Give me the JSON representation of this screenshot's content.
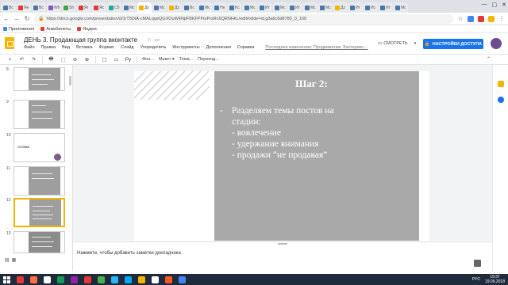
{
  "browser": {
    "tabs": [
      {
        "label": "Bc",
        "color": "#4a76a8"
      },
      {
        "label": "Ян",
        "color": "#e53935"
      },
      {
        "label": "Bc",
        "color": "#4a76a8"
      },
      {
        "label": "Wh",
        "color": "#7e57c2"
      },
      {
        "label": "Sh",
        "color": "#43a047"
      },
      {
        "label": "Яr",
        "color": "#e53935"
      },
      {
        "label": "Яc",
        "color": "#e53935"
      },
      {
        "label": "Сб",
        "color": "#26a69a"
      },
      {
        "label": "Mc",
        "color": "#4a76a8"
      },
      {
        "label": "Дo",
        "color": "#f4b400",
        "active": true
      },
      {
        "label": "Mc",
        "color": "#4a76a8"
      },
      {
        "label": "Дz",
        "color": "#f4b400"
      },
      {
        "label": "Bc",
        "color": "#4a76a8"
      },
      {
        "label": "Mc",
        "color": "#4a76a8"
      },
      {
        "label": "He",
        "color": "#4a76a8"
      },
      {
        "label": "Kc",
        "color": "#4a76a8"
      },
      {
        "label": "Mc",
        "color": "#4a76a8"
      },
      {
        "label": "Ит",
        "color": "#4a76a8"
      },
      {
        "label": "Mc",
        "color": "#4a76a8"
      },
      {
        "label": "Ит",
        "color": "#4a76a8"
      },
      {
        "label": "Mc",
        "color": "#4a76a8"
      },
      {
        "label": "Mc",
        "color": "#4a76a8"
      },
      {
        "label": "Дz",
        "color": "#f4b400"
      },
      {
        "label": "Ит",
        "color": "#4a76a8"
      },
      {
        "label": "Ис",
        "color": "#4a76a8"
      },
      {
        "label": "Ит",
        "color": "#4a76a8"
      },
      {
        "label": "Mc",
        "color": "#4a76a8"
      }
    ],
    "window_controls": [
      "—",
      "▢",
      "✕"
    ],
    "url": "https://docs.google.com/presentation/d/1rT5DtA-cMALqqeQGXOuW4NpFBKFPFtnPrsRc6QRNHkL/edit#slide=id.g3a6c6d8780_0_160",
    "bookmarks": [
      {
        "label": "Приложения",
        "color": "#4285f4"
      },
      {
        "label": "Анкибилеты",
        "color": "#e53935"
      },
      {
        "label": "Яндекс",
        "color": "#e53935"
      }
    ]
  },
  "doc": {
    "title": "ДЕНЬ 3. Продающая группа вконтакте",
    "menu": [
      "Файл",
      "Правка",
      "Вид",
      "Вставка",
      "Формат",
      "Слайд",
      "Упорядочить",
      "Инструменты",
      "Дополнения",
      "Справка"
    ],
    "last_edit": "Последнее изменение: Продвижение Эзотерико…",
    "watch_label": "СМОТРЕТЬ",
    "share_label": "НАСТРОЙКИ ДОСТУПА",
    "brand_color": "#1a73e8",
    "slides_color": "#f4b400"
  },
  "toolbar": {
    "items": [
      "+",
      "↶",
      "↷",
      "🖶",
      "⬚",
      "⊖",
      "⊕",
      "▢",
      "▭"
    ],
    "font_size_glyph": "Ру",
    "buttons": [
      "Фон...",
      "Макет ▾",
      "Тема...",
      "Переход..."
    ]
  },
  "filmstrip": {
    "numbers": [
      "8",
      "9",
      "10",
      "11",
      "12",
      "13"
    ],
    "thumb10_text": "готовы!"
  },
  "slide": {
    "title": "Шаг 2:",
    "bullet_dash": "-",
    "bullet_line1": "Разделяем темы постов на",
    "bullet_line2": "стадии:",
    "sub1": "- вовлечение",
    "sub2": "- удержание внимания",
    "sub3": "- продажи “не продавая”"
  },
  "notes": {
    "placeholder": "Нажмите, чтобы добавить заметки докладчика"
  },
  "taskbar": {
    "apps": [
      "#e53935",
      "#ff7043",
      "#ffffff",
      "#0f9d58",
      "#8e24aa",
      "#e53935",
      "#4caf50",
      "#29b6f6",
      "#03a9f4",
      "#f4b400",
      "#ffffff",
      "#ff5722",
      "#4285f4"
    ],
    "lang": "РУС",
    "time": "19:37",
    "date": "19.09.2018"
  }
}
